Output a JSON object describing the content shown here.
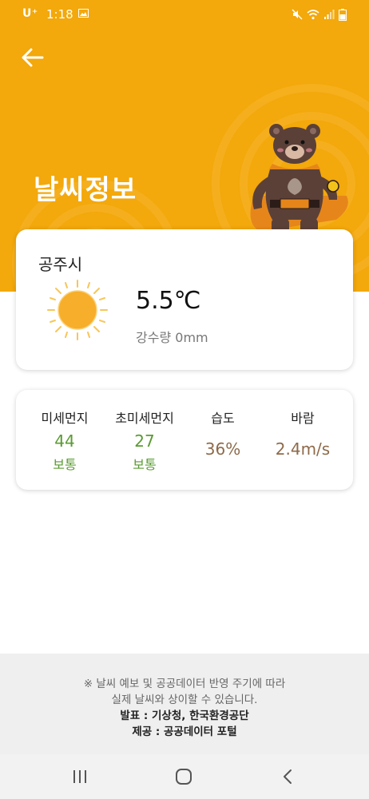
{
  "status_bar": {
    "carrier": "U⁺",
    "time": "1:18",
    "battery_level": "7"
  },
  "header": {
    "title": "날씨정보"
  },
  "weather": {
    "city": "공주시",
    "icon": "sun-icon",
    "temperature": "5.5℃",
    "rainfall_label": "강수량",
    "rainfall_value": "0mm"
  },
  "metrics": {
    "pm10": {
      "label": "미세먼지",
      "value": "44",
      "status": "보통"
    },
    "pm25": {
      "label": "초미세먼지",
      "value": "27",
      "status": "보통"
    },
    "humidity": {
      "label": "습도",
      "value": "36%"
    },
    "wind": {
      "label": "바람",
      "value": "2.4m/s"
    }
  },
  "footer": {
    "notice_line1": "※ 날씨 예보 및 공공데이터 반영 주기에 따라",
    "notice_line2": "실제 날씨와 상이할 수 있습니다.",
    "source": "발표 : 기상청, 한국환경공단",
    "provider": "제공 : 공공데이터 포털"
  },
  "colors": {
    "header_bg": "#f3a80b",
    "good_status": "#5a9b32",
    "metric_brown": "#8e6a4a",
    "sun": "#f7ae2a"
  }
}
